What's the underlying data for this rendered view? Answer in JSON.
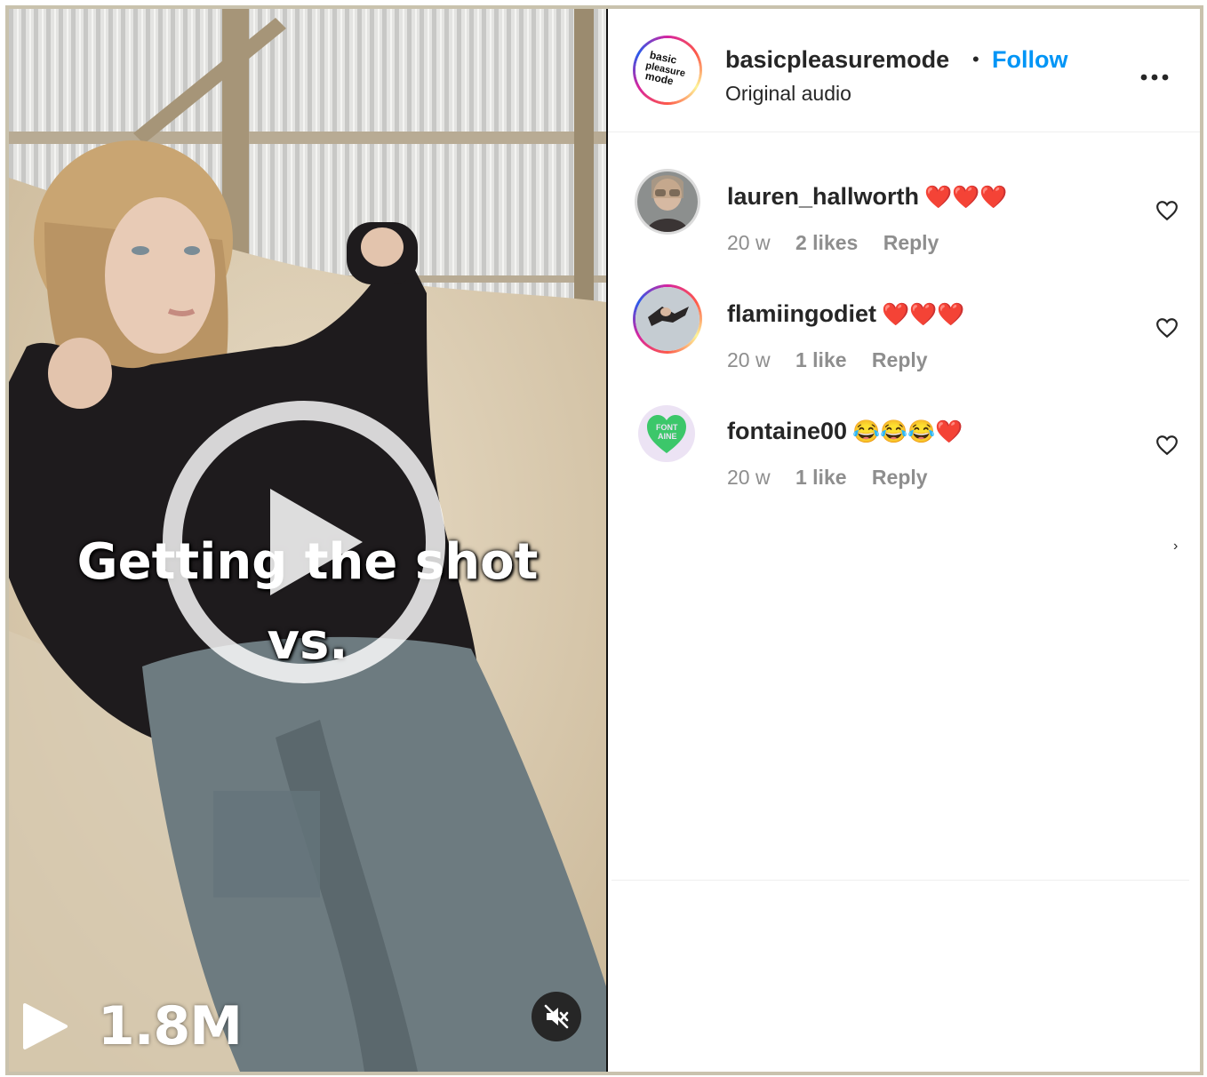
{
  "post": {
    "caption_line1": "Getting the shot",
    "caption_line2": "vs.",
    "views": "1.8M",
    "icons": {
      "play_overlay": "play-circle-icon",
      "views_play": "play-icon",
      "mute": "speaker-muted-icon"
    }
  },
  "header": {
    "username": "basicpleasuremode",
    "separator": "•",
    "follow_label": "Follow",
    "audio_label": "Original audio",
    "more_label": "•••",
    "avatar_text": "basic pleasure mode"
  },
  "comments": [
    {
      "username": "lauren_hallworth",
      "text": "❤️❤️❤️",
      "time": "20 w",
      "likes": "2 likes",
      "reply_label": "Reply"
    },
    {
      "username": "flamiingodiet",
      "text": "❤️❤️❤️",
      "time": "20 w",
      "likes": "1 like",
      "reply_label": "Reply"
    },
    {
      "username": "fontaine00",
      "text": "😂😂😂❤️",
      "time": "20 w",
      "likes": "1 like",
      "reply_label": "Reply",
      "avatar_text": "FONT AINE"
    }
  ],
  "colors": {
    "frame_border": "#c9c2ad",
    "follow_blue": "#0095f6",
    "text_primary": "#262626",
    "text_secondary": "#8e8e8e",
    "heart_red": "#e0243b"
  }
}
